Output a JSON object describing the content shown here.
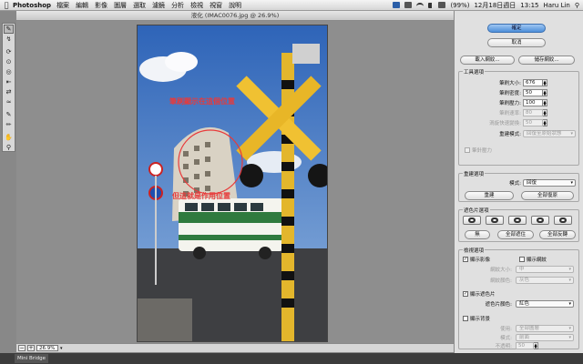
{
  "menubar": {
    "app": "Photoshop",
    "items": [
      "檔案",
      "編輯",
      "影像",
      "圖層",
      "選取",
      "濾鏡",
      "分析",
      "檢視",
      "視窗",
      "說明"
    ],
    "battery": "(99%)",
    "date": "12月18日週日",
    "time": "13:15",
    "user": "Haru Lin"
  },
  "document": {
    "title": "液化 (IMAC0076.jpg @ 26.9%)",
    "zoom": "26.9%"
  },
  "annotations": {
    "brush_note": "筆刷顯示在這個位置",
    "apply_note": "但這就是作用位置"
  },
  "panel": {
    "ok": "確定",
    "cancel": "取消",
    "load_mesh": "載入網紋...",
    "save_mesh": "儲存網紋...",
    "tool_options": {
      "title": "工具選項",
      "brush_size": {
        "label": "筆刷大小:",
        "value": "676"
      },
      "brush_density": {
        "label": "筆刷密度:",
        "value": "50"
      },
      "brush_pressure": {
        "label": "筆刷壓力:",
        "value": "100"
      },
      "brush_rate": {
        "label": "筆刷速率:",
        "value": "80"
      },
      "turbulent_jitter": {
        "label": "渦旋快速變換:",
        "value": "50"
      },
      "reconstruct_mode": {
        "label": "重建模式:",
        "value": "回復至原始狀態"
      },
      "stylus_pressure": "筆針壓力"
    },
    "reconstruct_options": {
      "title": "重建選項",
      "mode_label": "模式:",
      "mode_value": "回復",
      "reconstruct": "重建",
      "restore_all": "全部復原"
    },
    "mask_options": {
      "title": "遮色片選項",
      "none": "無",
      "mask_all": "全部遮住",
      "invert_all": "全部反轉"
    },
    "view_options": {
      "title": "檢視選項",
      "show_image": "顯示影像",
      "show_mesh": "顯示網紋",
      "mesh_size": {
        "label": "網紋大小:",
        "value": "中"
      },
      "mesh_color": {
        "label": "網紋顏色:",
        "value": "灰色"
      },
      "show_mask": "顯示遮色片",
      "mask_color": {
        "label": "遮色片顏色:",
        "value": "紅色"
      },
      "show_backdrop": "顯示背景",
      "use": {
        "label": "使用:",
        "value": "全部圖層"
      },
      "mode": {
        "label": "模式:",
        "value": "前面"
      },
      "opacity": {
        "label": "不透明:",
        "value": "50"
      }
    }
  },
  "dock": {
    "item": "Mini Bridge"
  },
  "colors": {
    "accent": "#4d8fd9",
    "annotation": "#e83a3a"
  }
}
